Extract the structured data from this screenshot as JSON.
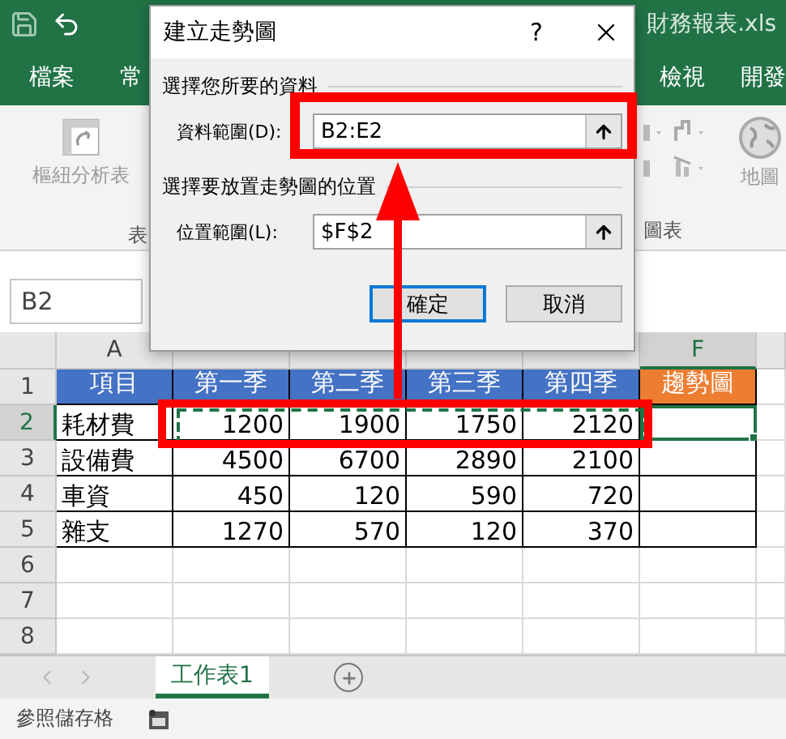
{
  "title_bar": {
    "file_name": "財務報表.xls"
  },
  "ribbon_tabs_left": [
    {
      "label": "檔案"
    },
    {
      "label": "常"
    }
  ],
  "ribbon_tabs_right": [
    {
      "label": "檢視"
    },
    {
      "label": "開發"
    }
  ],
  "ribbon": {
    "pivot_label": "樞紐分析表",
    "left_group": "表",
    "right_group": "圖表",
    "map_label": "地圖"
  },
  "name_box": {
    "value": "B2"
  },
  "columns": [
    {
      "label": "A",
      "selected": false
    },
    {
      "selected": false
    },
    {
      "selected": false
    },
    {
      "selected": false
    },
    {
      "selected": false
    },
    {
      "label": "F",
      "selected": true
    }
  ],
  "rows": [
    {
      "number": "1",
      "kind": "header",
      "selected": false,
      "cells": [
        {
          "text": "項目",
          "color": "#4472c4"
        },
        {
          "text": "第一季",
          "color": "#4472c4"
        },
        {
          "text": "第二季",
          "color": "#4472c4"
        },
        {
          "text": "第三季",
          "color": "#4472c4"
        },
        {
          "text": "第四季",
          "color": "#4472c4"
        },
        {
          "text": "趨勢圖",
          "color": "#ed7d31"
        }
      ]
    },
    {
      "number": "2",
      "kind": "data",
      "selected": true,
      "cells": [
        {
          "text": "耗材費"
        },
        {
          "text": "1200"
        },
        {
          "text": "1900"
        },
        {
          "text": "1750"
        },
        {
          "text": "2120"
        }
      ]
    },
    {
      "number": "3",
      "kind": "data",
      "selected": false,
      "cells": [
        {
          "text": "設備費"
        },
        {
          "text": "4500"
        },
        {
          "text": "6700"
        },
        {
          "text": "2890"
        },
        {
          "text": "2100"
        }
      ]
    },
    {
      "number": "4",
      "kind": "data",
      "selected": false,
      "cells": [
        {
          "text": "車資"
        },
        {
          "text": "450"
        },
        {
          "text": "120"
        },
        {
          "text": "590"
        },
        {
          "text": "720"
        }
      ]
    },
    {
      "number": "5",
      "kind": "data",
      "selected": false,
      "cells": [
        {
          "text": "雜支"
        },
        {
          "text": "1270"
        },
        {
          "text": "570"
        },
        {
          "text": "120"
        },
        {
          "text": "370"
        }
      ]
    },
    {
      "number": "6",
      "kind": "blank",
      "selected": false
    },
    {
      "number": "7",
      "kind": "blank",
      "selected": false
    },
    {
      "number": "8",
      "kind": "blank",
      "selected": false
    }
  ],
  "dialog": {
    "title": "建立走勢圖",
    "help": "?",
    "sections": [
      {
        "heading": "選擇您所要的資料",
        "field_label": "資料範圍(D):",
        "value": "B2:E2"
      },
      {
        "heading": "選擇要放置走勢圖的位置",
        "field_label": "位置範圍(L):",
        "value": "$F$2"
      }
    ],
    "buttons": [
      {
        "label": "確定",
        "default": true
      },
      {
        "label": "取消",
        "default": false
      }
    ]
  },
  "sheet_tabs": [
    {
      "label": "工作表1",
      "selected": true
    }
  ],
  "status_bar": {
    "text": "參照儲存格"
  }
}
